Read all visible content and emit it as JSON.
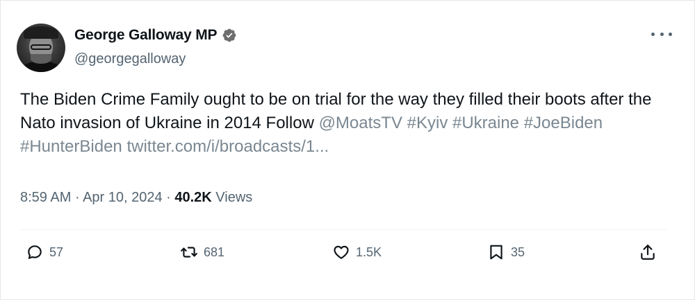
{
  "author": {
    "name": "George Galloway MP",
    "handle": "@georgegalloway"
  },
  "tweet": {
    "text_plain": "The Biden Crime Family ought to be on trial for the way they filled their boots after the Nato invasion of Ukraine in 2014  Follow ",
    "mention": "@MoatsTV",
    "hashtag_kyiv": "#Kyiv",
    "hashtag_ukraine": "#Ukraine",
    "hashtag_joebiden": "#JoeBiden",
    "hashtag_hunterbiden": "#HunterBiden",
    "link": "twitter.com/i/broadcasts/1..."
  },
  "meta": {
    "time": "8:59 AM",
    "separator_1": " · ",
    "date": "Apr 10, 2024",
    "separator_2": " · ",
    "views_count": "40.2K",
    "views_label": " Views"
  },
  "actions": {
    "replies": "57",
    "reposts": "681",
    "likes": "1.5K",
    "bookmarks": "35"
  },
  "icons": {
    "verified": "verified-badge-icon",
    "more": "more-icon",
    "reply": "reply-icon",
    "repost": "repost-icon",
    "like": "heart-icon",
    "bookmark": "bookmark-icon",
    "share": "share-icon"
  },
  "colors": {
    "text": "#0f1419",
    "secondary": "#536471",
    "link": "#7a8791"
  }
}
